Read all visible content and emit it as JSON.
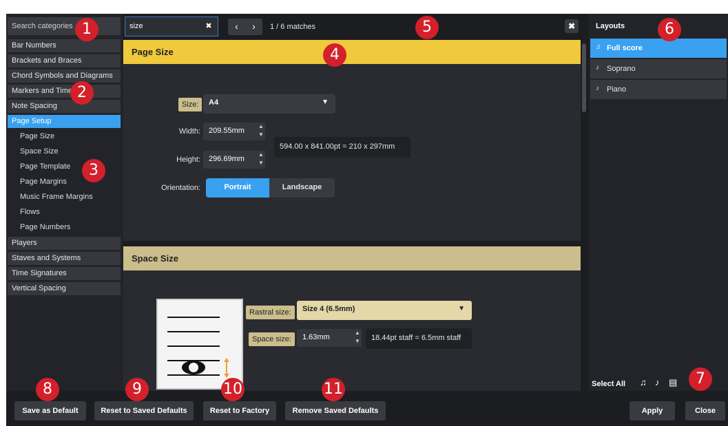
{
  "categories": {
    "search_placeholder": "Search categories",
    "items": [
      {
        "label": "Bar Numbers"
      },
      {
        "label": "Brackets and Braces"
      },
      {
        "label": "Chord Symbols and Diagrams"
      },
      {
        "label": "Markers and Time"
      },
      {
        "label": "Note Spacing"
      },
      {
        "label": "Page Setup"
      },
      {
        "label": "Players"
      },
      {
        "label": "Staves and Systems"
      },
      {
        "label": "Time Signatures"
      },
      {
        "label": "Vertical Spacing"
      }
    ],
    "subitems": [
      {
        "label": "Page Size"
      },
      {
        "label": "Space Size"
      },
      {
        "label": "Page Template"
      },
      {
        "label": "Page Margins"
      },
      {
        "label": "Music Frame Margins"
      },
      {
        "label": "Flows"
      },
      {
        "label": "Page Numbers"
      }
    ]
  },
  "find": {
    "query": "size",
    "clear_icon": "✖",
    "prev_icon": "‹",
    "next_icon": "›",
    "matches": "1 / 6 matches",
    "close_icon": "✖"
  },
  "page_size": {
    "title": "Page Size",
    "size_label": "Size:",
    "size_value": "A4",
    "width_label": "Width:",
    "width_value": "209.55mm",
    "height_label": "Height:",
    "height_value": "296.69mm",
    "dims_info": "594.00 x 841.00pt = 210 x 297mm",
    "orientation_label": "Orientation:",
    "portrait": "Portrait",
    "landscape": "Landscape"
  },
  "space_size": {
    "title": "Space Size",
    "rastral_label": "Rastral size:",
    "rastral_value": "Size 4 (6.5mm)",
    "space_label": "Space size:",
    "space_value": "1.63mm",
    "staff_info": "18.44pt staff = 6.5mm staff"
  },
  "layouts": {
    "title": "Layouts",
    "items": [
      {
        "label": "Full score"
      },
      {
        "label": "Soprano"
      },
      {
        "label": "Piano"
      }
    ],
    "select_all": "Select All"
  },
  "buttons": {
    "save_default": "Save as Default",
    "reset_saved": "Reset to Saved Defaults",
    "reset_factory": "Reset to Factory",
    "remove_saved": "Remove Saved Defaults",
    "apply": "Apply",
    "close": "Close"
  },
  "callouts": [
    "1",
    "2",
    "3",
    "4",
    "5",
    "6",
    "7",
    "8",
    "9",
    "10",
    "11"
  ],
  "colors": {
    "selected_blue": "#3aa0f0",
    "highlight_yellow": "#f0c93c",
    "section_tan": "#cbbd8c",
    "callout_red": "#d3202a"
  }
}
